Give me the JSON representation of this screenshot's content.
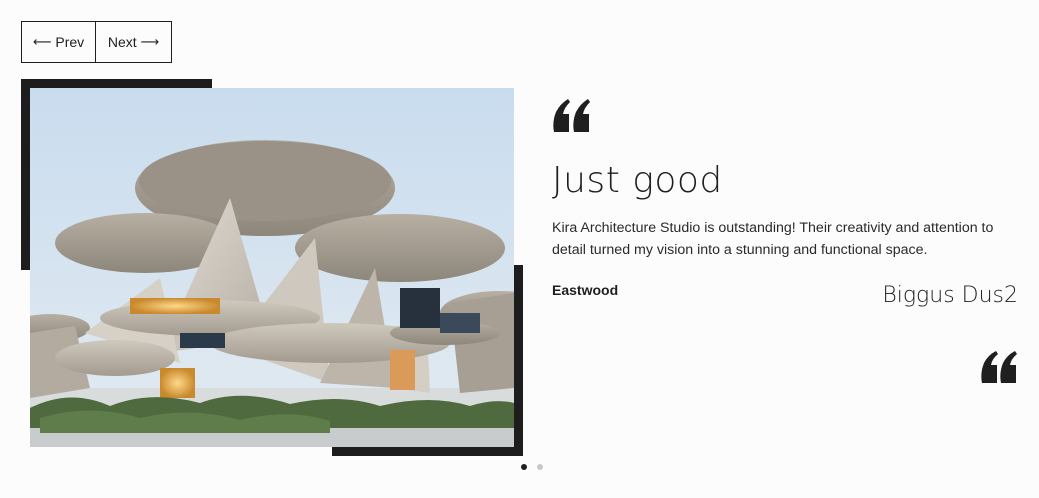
{
  "navigation": {
    "prev_label": "Prev",
    "next_label": "Next",
    "prev_arrow": "⟵",
    "next_arrow": "⟶"
  },
  "testimonial": {
    "title": "Just good",
    "text": "Kira Architecture Studio is outstanding! Their creativity and attention to detail turned my vision into a stunning and functional space.",
    "author": "Eastwood",
    "signature": "Biggus Dus2"
  },
  "pagination": {
    "total": 2,
    "active_index": 0
  },
  "colors": {
    "accent": "#1d1d1d",
    "background": "#fcfcfc",
    "dot_inactive": "#c8c8c8"
  },
  "icons": {
    "open_quote": "quote-open-icon",
    "close_quote": "quote-close-icon"
  },
  "image": {
    "subject": "museum-building-photo"
  }
}
